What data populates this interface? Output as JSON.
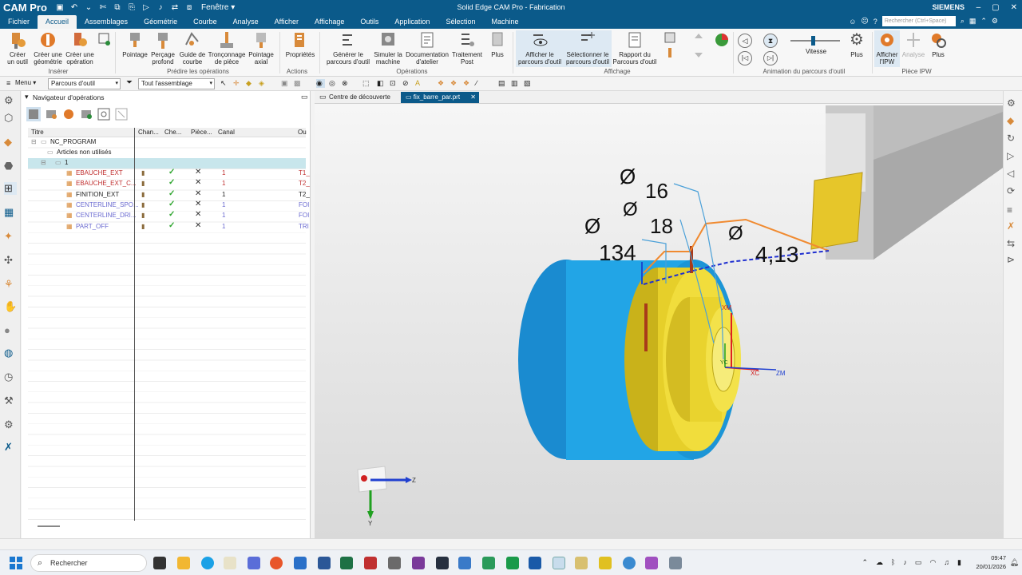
{
  "app": {
    "logo": "CAM Pro",
    "window_title": "Solid Edge CAM Pro - Fabrication",
    "brand": "SIEMENS",
    "window_menu": "Fenêtre ▾",
    "search_placeholder": "Rechercher (Ctrl+Space)"
  },
  "menu": {
    "tabs": [
      "Fichier",
      "Accueil",
      "Assemblages",
      "Géométrie",
      "Courbe",
      "Analyse",
      "Afficher",
      "Affichage",
      "Outils",
      "Application",
      "Sélection",
      "Machine"
    ]
  },
  "ribbon": {
    "buttons": {
      "create_tool": "Créer\nun outil",
      "create_geometry": "Créer une\ngéométrie",
      "create_operation": "Créer une\nopération",
      "spot_drill": "Pointage",
      "deep_drill": "Perçage\nprofond",
      "guide_curve": "Guide de\ncourbe",
      "part_off": "Tronçonnage\nde pièce",
      "axial_spot": "Pointage\naxial",
      "properties": "Propriétés",
      "generate": "Générer le\nparcours d'outil",
      "simulate": "Simuler la\nmachine",
      "shop_doc": "Documentation\nd'atelier",
      "post": "Traitement\nPost",
      "more_ops": "Plus",
      "show_toolpath": "Afficher le\nparcours d'outil",
      "select_toolpath": "Sélectionner le\nparcours d'outil",
      "toolpath_report": "Rapport du\nParcours d'outil",
      "more_anim": "Plus",
      "show_ipw": "Afficher\nl'IPW",
      "analysis": "Analyse",
      "more_ipw": "Plus",
      "speed": "Vitesse"
    },
    "groups": {
      "insert": "Insérer",
      "predict": "Prédire les opérations",
      "actions": "Actions",
      "operations": "Opérations",
      "display": "Affichage",
      "animation": "Animation du parcours d'outil",
      "ipw": "Pièce IPW"
    },
    "speed_level": 0.45
  },
  "toolbar2": {
    "menu": "Menu ▾",
    "filter_1": "Parcours d'outil",
    "filter_2": "Tout l'assemblage"
  },
  "navigator": {
    "title": "Navigateur d'opérations",
    "columns": [
      "Titre",
      "Chan...",
      "Che...",
      "Pièce...",
      "Canal",
      "Ou"
    ],
    "root": "NC_PROGRAM",
    "unused": "Articles non utilisés",
    "group": "1",
    "operations": [
      {
        "name": "EBAUCHE_EXT",
        "canal": "1",
        "tool": "T1_",
        "color": "red"
      },
      {
        "name": "EBAUCHE_EXT_C...",
        "canal": "1",
        "tool": "T2_",
        "color": "red"
      },
      {
        "name": "FINITION_EXT",
        "canal": "1",
        "tool": "T2_",
        "color": "black"
      },
      {
        "name": "CENTERLINE_SPO...",
        "canal": "1",
        "tool": "FOI",
        "color": "blue"
      },
      {
        "name": "CENTERLINE_DRI...",
        "canal": "1",
        "tool": "FOI",
        "color": "blue"
      },
      {
        "name": "PART_OFF",
        "canal": "1",
        "tool": "TRI",
        "color": "blue"
      }
    ]
  },
  "doc_tabs": {
    "discovery": "Centre de découverte",
    "part": "fix_barre_par.prt"
  },
  "viewport": {
    "annotations": [
      "Ø",
      "16",
      "Ø",
      "18",
      "Ø",
      "134",
      "Ø",
      "4,13"
    ],
    "axes": {
      "xm": "XM",
      "xc": "XC",
      "zm": "ZM",
      "yc": "YC",
      "z": "Z",
      "y": "Y"
    }
  },
  "taskbar": {
    "search": "Rechercher",
    "time": "09:47",
    "date": "20/01/2026"
  }
}
